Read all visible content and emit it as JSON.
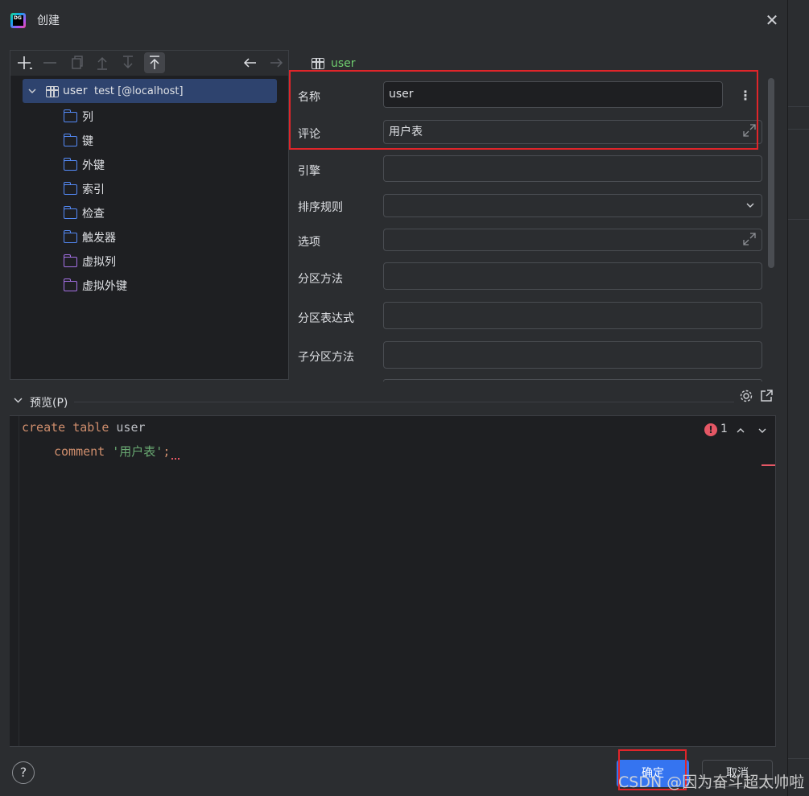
{
  "window": {
    "title": "创建",
    "logo_text": "DG",
    "close_glyph": "✕"
  },
  "toolbar": {
    "icons": [
      "add-icon",
      "remove-icon",
      "copy-icon",
      "move-up-icon",
      "move-down-icon",
      "move-top-icon",
      "back-icon",
      "forward-icon"
    ]
  },
  "tree": {
    "root_label": "user",
    "root_sub": "test [@localhost]",
    "items": [
      {
        "label": "列",
        "color": "#548af7"
      },
      {
        "label": "键",
        "color": "#548af7"
      },
      {
        "label": "外键",
        "color": "#548af7"
      },
      {
        "label": "索引",
        "color": "#548af7"
      },
      {
        "label": "检查",
        "color": "#548af7"
      },
      {
        "label": "触发器",
        "color": "#548af7"
      },
      {
        "label": "虚拟列",
        "color": "#a571e6"
      },
      {
        "label": "虚拟外键",
        "color": "#a571e6"
      }
    ]
  },
  "form": {
    "tab_label": "user",
    "fields": [
      {
        "label": "名称",
        "value": "user"
      },
      {
        "label": "评论",
        "value": "用户表"
      },
      {
        "label": "引擎",
        "value": ""
      },
      {
        "label": "排序规则",
        "value": ""
      },
      {
        "label": "选项",
        "value": ""
      },
      {
        "label": "分区方法",
        "value": ""
      },
      {
        "label": "分区表达式",
        "value": ""
      },
      {
        "label": "子分区方法",
        "value": ""
      }
    ]
  },
  "preview": {
    "title": "预览(P)",
    "line1_kw1": "create",
    "line1_kw2": "table",
    "line1_id": "user",
    "line2_kw": "comment",
    "line2_str": "'用户表'",
    "line2_end": ";",
    "error_count": "1"
  },
  "footer": {
    "help_glyph": "?",
    "ok_label": "确定",
    "cancel_label": "取消"
  },
  "watermark": "CSDN @因为奋斗超太帅啦",
  "colors": {
    "accent": "#3574f0",
    "highlight": "#e0252a",
    "keyword": "#cf8e6d",
    "string": "#6aab73",
    "error": "#e55765"
  }
}
